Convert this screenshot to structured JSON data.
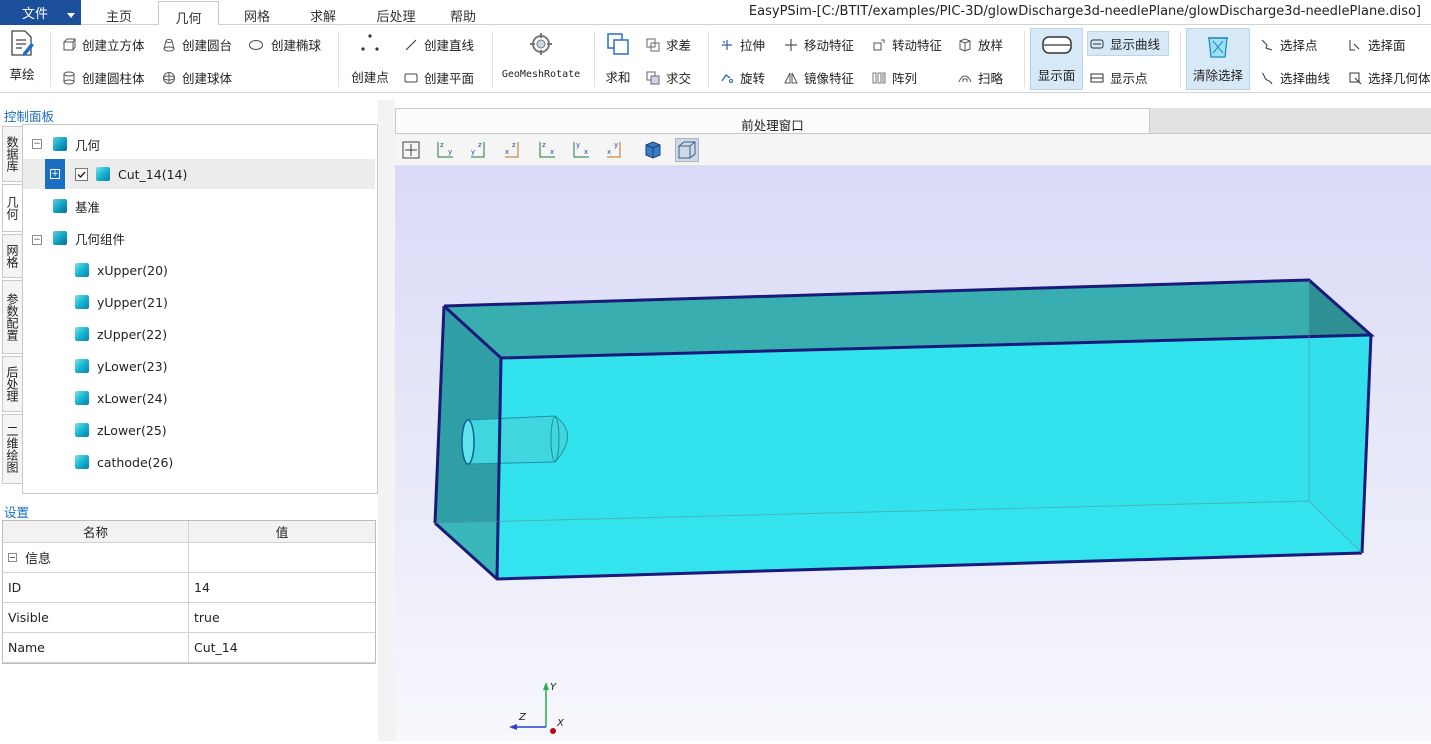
{
  "menubar": {
    "file_label": "文件",
    "tabs": [
      "主页",
      "几何",
      "网格",
      "求解",
      "后处理",
      "帮助"
    ],
    "active_tab": "几何",
    "title": "EasyPSim-[C:/BTIT/examples/PIC-3D/glowDischarge3d-needlePlane/glowDischarge3d-needlePlane.diso]"
  },
  "ribbon": {
    "sketch": "草绘",
    "create_box": "创建立方体",
    "create_cylinder": "创建圆柱体",
    "create_cone": "创建圆台",
    "create_sphere": "创建球体",
    "create_ellipsoid": "创建椭球",
    "create_point": "创建点",
    "create_line": "创建直线",
    "create_plane": "创建平面",
    "geo_mesh_rotate": "GeoMeshRotate",
    "union": "求和",
    "difference": "求差",
    "intersect": "求交",
    "extrude": "拉伸",
    "revolve": "旋转",
    "move_feature": "移动特征",
    "mirror_feature": "镜像特征",
    "rotate_feature": "转动特征",
    "array": "阵列",
    "loft": "放样",
    "sweep": "扫略",
    "show_faces": "显示面",
    "show_curves": "显示曲线",
    "show_points": "显示点",
    "clear_selection": "清除选择",
    "select_point": "选择点",
    "select_curve": "选择曲线",
    "select_face": "选择面",
    "select_geometry": "选择几何体"
  },
  "control_panel": {
    "title": "控制面板",
    "side_tabs": [
      "数据库",
      "几何",
      "网格",
      "参数配置",
      "后处理",
      "二维绘图"
    ],
    "active_side_tab": "几何",
    "tree": {
      "root": "几何",
      "cut_item": "Cut_14(14)",
      "datum": "基准",
      "components": "几何组件",
      "children": [
        "xUpper(20)",
        "yUpper(21)",
        "zUpper(22)",
        "yLower(23)",
        "xLower(24)",
        "zLower(25)",
        "cathode(26)"
      ]
    }
  },
  "settings": {
    "title": "设置",
    "col_name": "名称",
    "col_value": "值",
    "group": "信息",
    "rows": [
      {
        "key": "ID",
        "value": "14"
      },
      {
        "key": "Visible",
        "value": "true"
      },
      {
        "key": "Name",
        "value": "Cut_14"
      }
    ]
  },
  "viewport": {
    "tab_label": "前处理窗口",
    "axis_labels": {
      "y": "Y",
      "z": "Z",
      "x": "X"
    }
  },
  "colors": {
    "accent": "#1a6fc2",
    "file_button": "#1b4f9c",
    "box_fill": "#2ee6f0",
    "box_edge": "#1a1a7a"
  }
}
